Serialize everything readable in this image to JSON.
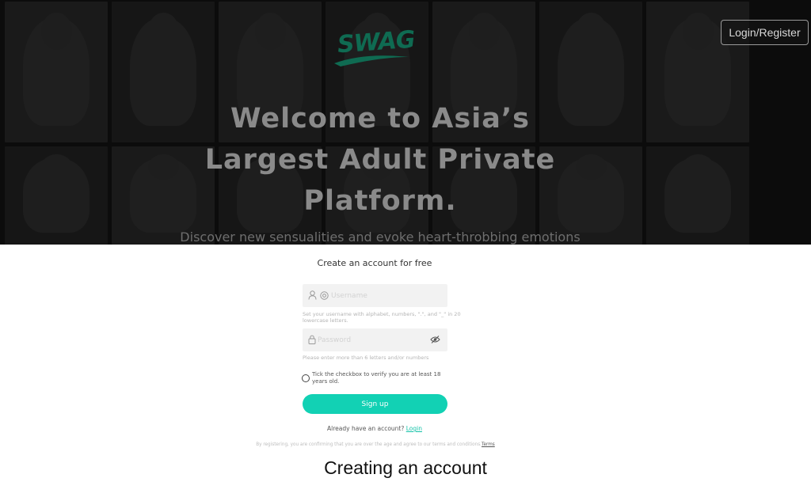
{
  "header": {
    "logo_text": "SWAG",
    "login_button": "Login/Register"
  },
  "hero": {
    "title_line1": "Welcome to Asia’s",
    "title_line2": "Largest Adult Private",
    "title_line3": "Platform.",
    "subtitle": "Discover new sensualities and evoke heart-throbbing emotions"
  },
  "form": {
    "title": "Create an account for free",
    "username": {
      "placeholder": "Username",
      "value": "",
      "hint": "Set your username with alphabet, numbers, \".\", and \"_\" in 20 lowercase letters."
    },
    "password": {
      "placeholder": "Password",
      "value": "",
      "hint": "Please enter more than 6 letters and/or numbers"
    },
    "age_checkbox_label": "Tick the checkbox to verify you are at least 18 years old.",
    "signup_button": "Sign up",
    "have_account_text": "Already have an account?",
    "login_link": "Login",
    "terms_text": "By registering, you are confirming that you are over the age and agree to our terms and conditions.",
    "terms_link": "Terms"
  },
  "caption": "Creating an account",
  "colors": {
    "accent": "#12d1b4",
    "logo": "#0f6b52",
    "hero_background": "#0e0e0e"
  },
  "icons": {
    "user": "user-icon",
    "at": "at-icon",
    "lock": "lock-icon",
    "eye_off": "eye-off-icon"
  }
}
